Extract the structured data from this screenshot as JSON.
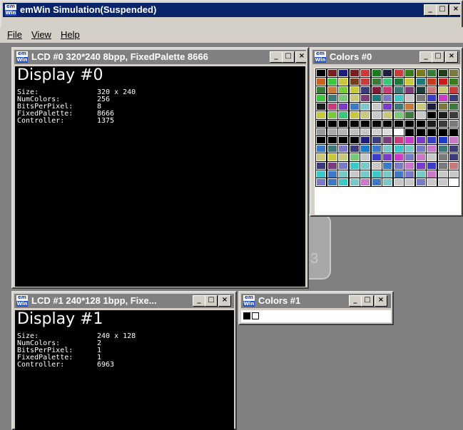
{
  "main_window": {
    "title": "emWin Simulation(Suspended)"
  },
  "menu": {
    "items": [
      "File",
      "View",
      "Help"
    ]
  },
  "lcd0": {
    "title": "LCD #0 320*240 8bpp, FixedPalette 8666",
    "heading": "Display #0",
    "rows": [
      {
        "label": "Size:",
        "value": "320 x 240"
      },
      {
        "label": "NumColors:",
        "value": "256"
      },
      {
        "label": "BitsPerPixel:",
        "value": "8"
      },
      {
        "label": "FixedPalette:",
        "value": "8666"
      },
      {
        "label": "Controller:",
        "value": "1375"
      }
    ]
  },
  "lcd1": {
    "title": "LCD #1 240*128 1bpp, Fixe...",
    "heading": "Display #1",
    "rows": [
      {
        "label": "Size:",
        "value": "240 x 128"
      },
      {
        "label": "NumColors:",
        "value": "2"
      },
      {
        "label": "BitsPerPixel:",
        "value": "1"
      },
      {
        "label": "FixedPalette:",
        "value": "1"
      },
      {
        "label": "Controller:",
        "value": "6963"
      }
    ]
  },
  "colors0": {
    "title": "Colors #0",
    "palette": [
      "#000000",
      "#7a1e1e",
      "#1e1e7a",
      "#7a1e1e",
      "#c83c3c",
      "#1e7a1e",
      "#1e1e3c",
      "#c83c3c",
      "#3c7a1e",
      "#7a7a1e",
      "#3c7a3c",
      "#1e3c1e",
      "#7a7a3c",
      "#c8641e",
      "#3cc83c",
      "#c8c83c",
      "#7a3c1e",
      "#c83c3c",
      "#3c7a3c",
      "#3cc87a",
      "#1e7a3c",
      "#c8c83c",
      "#1e7a7a",
      "#c83c1e",
      "#c81e1e",
      "#3c7a1e",
      "#3c7a3c",
      "#c87a3c",
      "#7ac83c",
      "#c8c83c",
      "#3c3c7a",
      "#7a1e3c",
      "#c83c7a",
      "#3c7a7a",
      "#7a3c7a",
      "#1e3c3c",
      "#c87a7a",
      "#c8c87a",
      "#c83c3c",
      "#3cc83c",
      "#3c7a7a",
      "#7ac87a",
      "#c8c87a",
      "#7a3c7a",
      "#1e7a7a",
      "#7a7ac8",
      "#3cc8c8",
      "#c8c8c8",
      "#7a7a7a",
      "#3c3cc8",
      "#c83cc8",
      "#3c3c7a",
      "#1e1e1e",
      "#c83c7a",
      "#7a3cc8",
      "#3c7ac8",
      "#7ac8c8",
      "#c8c8c8",
      "#7a3cc8",
      "#3c7a7a",
      "#c87a3c",
      "#c8c87a",
      "#1e1e3c",
      "#7a7a3c",
      "#3c7a3c",
      "#c8c83c",
      "#7ac83c",
      "#3cc87a",
      "#c8c83c",
      "#c8c87a",
      "#c8c8c8",
      "#c8c87a",
      "#7ac87a",
      "#3c7a3c",
      "#c8c8c8",
      "#000000",
      "#1e1e1e",
      "#3c3c3c",
      "#000000",
      "#000000",
      "#000000",
      "#000000",
      "#000000",
      "#000000",
      "#000000",
      "#000000",
      "#000000",
      "#000000",
      "#1e1e1e",
      "#3c3c3c",
      "#7a7a7a",
      "#9a9a9a",
      "#aaaaaa",
      "#b4b4b4",
      "#bebebe",
      "#c8c8c8",
      "#d2d2d2",
      "#dcdcdc",
      "#ffffff",
      "#000000",
      "#000000",
      "#000000",
      "#000000",
      "#000000",
      "#000000",
      "#000000",
      "#000000",
      "#000000",
      "#1e1e7a",
      "#3c3c7a",
      "#7a3c7a",
      "#c83c7a",
      "#c83cc8",
      "#7a3cc8",
      "#3c3cc8",
      "#1e3cc8",
      "#c87ac8",
      "#3c7ac8",
      "#3c7a7a",
      "#7a7ac8",
      "#3c3c7a",
      "#1e7ac8",
      "#3c7ac8",
      "#7ac8c8",
      "#3cc8c8",
      "#7ac8c8",
      "#7a7ac8",
      "#c87ac8",
      "#3c7a7a",
      "#3c3c7a",
      "#c8c87a",
      "#c8c83c",
      "#c8c87a",
      "#7ac87a",
      "#c8c8c8",
      "#3c3cc8",
      "#7a3cc8",
      "#c83cc8",
      "#7a7ac8",
      "#c87ac8",
      "#c8c8c8",
      "#7a7a7a",
      "#3c3c7a",
      "#3c3c7a",
      "#7a3c7a",
      "#7a7ac8",
      "#3cc8c8",
      "#7ac8c8",
      "#c8c8c8",
      "#3c7ac8",
      "#7a7ac8",
      "#c87ac8",
      "#7a3cc8",
      "#3c3cc8",
      "#7a7a7a",
      "#c87a7a",
      "#3cc8c8",
      "#3c7ac8",
      "#7ac8c8",
      "#c8c8c8",
      "#7ac8c8",
      "#3cc8c8",
      "#7ac8c8",
      "#3c7ac8",
      "#7a7ac8",
      "#7ac8c8",
      "#c87ac8",
      "#c8c8c8",
      "#c8c8c8",
      "#7a7ac8",
      "#3c7ac8",
      "#3cc8c8",
      "#7ac8c8",
      "#c87ac8",
      "#3c7ac8",
      "#7ac8c8",
      "#c8c8c8",
      "#c8c8c8",
      "#7a7ac8",
      "#c8c8c8",
      "#c8c8c8",
      "#ffffff"
    ]
  },
  "colors1": {
    "title": "Colors #1",
    "palette": [
      "#000000",
      "#ffffff"
    ]
  },
  "background_text": "3"
}
